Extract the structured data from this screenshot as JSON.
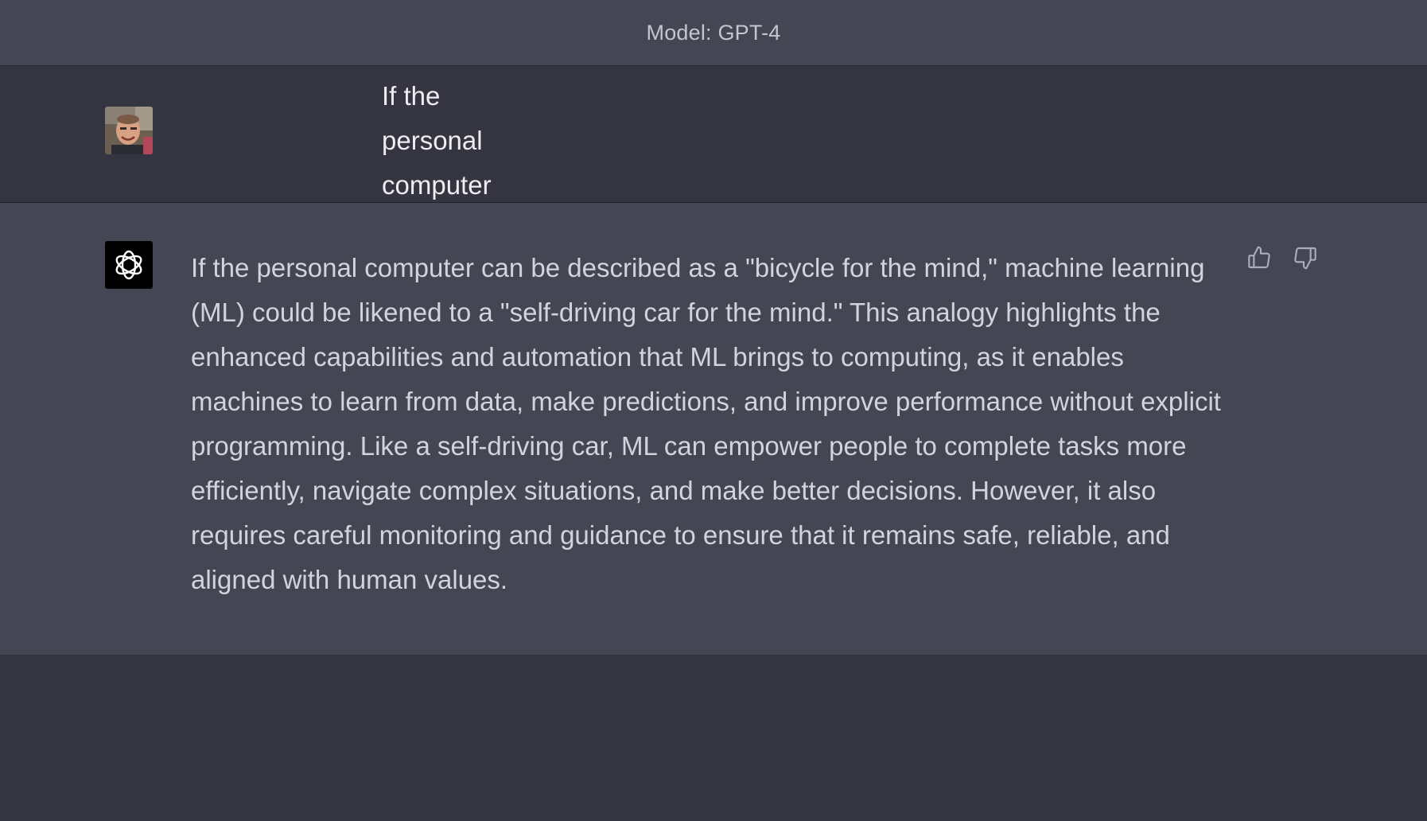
{
  "header": {
    "model_label": "Model: GPT-4"
  },
  "conversation": {
    "user_message": {
      "avatar": "user-photo-avatar",
      "text": "If the personal computer was a bicycle for the mind, what is ML?"
    },
    "assistant_message": {
      "avatar": "openai-logo-icon",
      "text": "If the personal computer can be described as a \"bicycle for the mind,\" machine learning (ML) could be likened to a \"self-driving car for the mind.\" This analogy highlights the enhanced capabilities and automation that ML brings to computing, as it enables machines to learn from data, make predictions, and improve performance without explicit programming. Like a self-driving car, ML can empower people to complete tasks more efficiently, navigate complex situations, and make better decisions. However, it also requires careful monitoring and guidance to ensure that it remains safe, reliable, and aligned with human values.",
      "feedback_icons": [
        "thumbs-up-icon",
        "thumbs-down-icon"
      ]
    }
  },
  "colors": {
    "header_bg": "#444654",
    "user_bg": "#343541",
    "assistant_bg": "#444654",
    "text_primary": "#ececf1",
    "text_assistant": "#d1d5db",
    "bot_avatar_bg": "#000000"
  }
}
